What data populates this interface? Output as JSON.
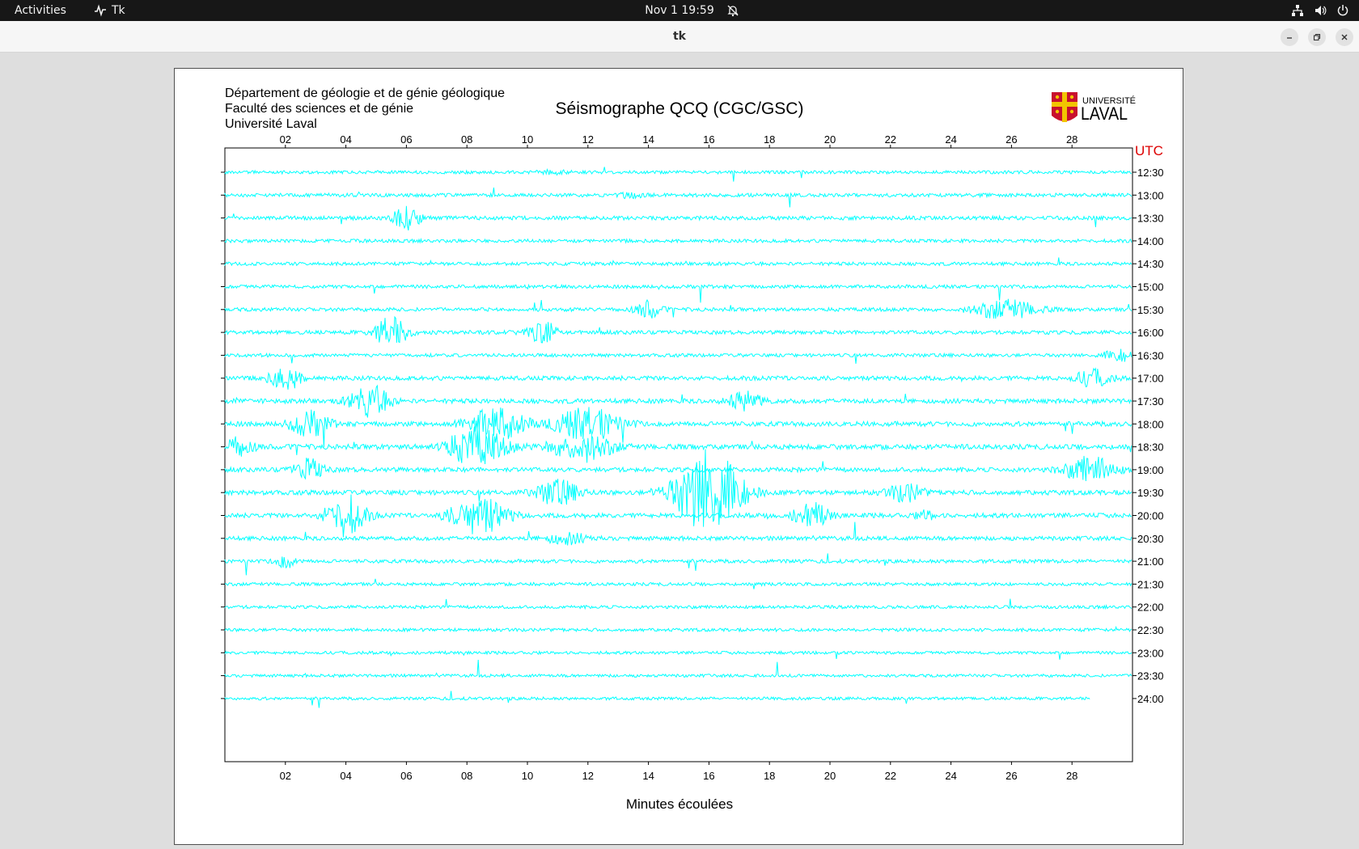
{
  "topbar": {
    "activities": "Activities",
    "app_name": "Tk",
    "clock": "Nov 1  19:59"
  },
  "window": {
    "title": "tk"
  },
  "header": {
    "institution_lines": [
      "Département de géologie et de génie géologique",
      "Faculté des sciences et de génie",
      "Université Laval"
    ],
    "title": "Séismographe QCQ (CGC/GSC)",
    "logo_text_top": "UNIVERSITÉ",
    "logo_text_bottom": "LAVAL"
  },
  "chart_data": {
    "type": "line",
    "title": "Séismographe QCQ (CGC/GSC)",
    "xlabel": "Minutes écoulées",
    "ylabel": "UTC",
    "xlim": [
      0,
      30
    ],
    "x_ticks": [
      "02",
      "04",
      "06",
      "08",
      "10",
      "12",
      "14",
      "16",
      "18",
      "20",
      "22",
      "24",
      "26",
      "28"
    ],
    "trace_labels": [
      "12:30",
      "13:00",
      "13:30",
      "14:00",
      "14:30",
      "15:00",
      "15:30",
      "16:00",
      "16:30",
      "17:00",
      "17:30",
      "18:00",
      "18:30",
      "19:00",
      "19:30",
      "20:00",
      "20:30",
      "21:00",
      "21:30",
      "22:00",
      "22:30",
      "23:00",
      "23:30",
      "24:00"
    ],
    "noise_level": [
      0.5,
      0.7,
      0.8,
      0.6,
      0.6,
      0.6,
      0.7,
      0.8,
      0.6,
      1.0,
      1.1,
      1.2,
      1.3,
      1.1,
      1.2,
      1.1,
      0.9,
      0.7,
      0.5,
      0.5,
      0.5,
      0.4,
      0.4,
      0.4
    ],
    "last_trace_end_minute": 28.6,
    "events": [
      [
        0,
        10.8,
        1.6,
        0.15
      ],
      [
        1,
        13.4,
        1.2,
        0.2
      ],
      [
        2,
        6.0,
        1.2,
        1.2
      ],
      [
        6,
        25.8,
        3.0,
        0.9
      ],
      [
        6,
        14.0,
        1.2,
        0.8
      ],
      [
        7,
        5.5,
        1.5,
        1.5
      ],
      [
        7,
        10.5,
        1.5,
        1.0
      ],
      [
        8,
        29.7,
        1.8,
        0.6
      ],
      [
        9,
        2.0,
        1.4,
        1.2
      ],
      [
        9,
        28.7,
        1.6,
        0.8
      ],
      [
        10,
        4.8,
        1.8,
        1.5
      ],
      [
        10,
        17.2,
        1.5,
        1.0
      ],
      [
        11,
        9.0,
        2.6,
        1.6
      ],
      [
        11,
        12.0,
        3.0,
        1.6
      ],
      [
        11,
        2.8,
        1.8,
        1.2
      ],
      [
        12,
        8.3,
        2.8,
        1.8
      ],
      [
        12,
        11.8,
        2.8,
        1.4
      ],
      [
        12,
        0.4,
        1.5,
        0.8
      ],
      [
        13,
        28.6,
        2.4,
        1.2
      ],
      [
        13,
        2.8,
        1.4,
        1.0
      ],
      [
        14,
        16.0,
        3.2,
        4.2
      ],
      [
        14,
        11.0,
        2.0,
        1.2
      ],
      [
        14,
        22.5,
        1.6,
        0.9
      ],
      [
        15,
        8.4,
        2.6,
        1.8
      ],
      [
        15,
        4.0,
        1.8,
        2.0
      ],
      [
        15,
        19.4,
        1.6,
        1.2
      ],
      [
        15,
        23.2,
        1.0,
        0.4
      ],
      [
        16,
        11.3,
        2.0,
        0.5
      ],
      [
        17,
        2.0,
        1.0,
        0.6
      ]
    ]
  }
}
